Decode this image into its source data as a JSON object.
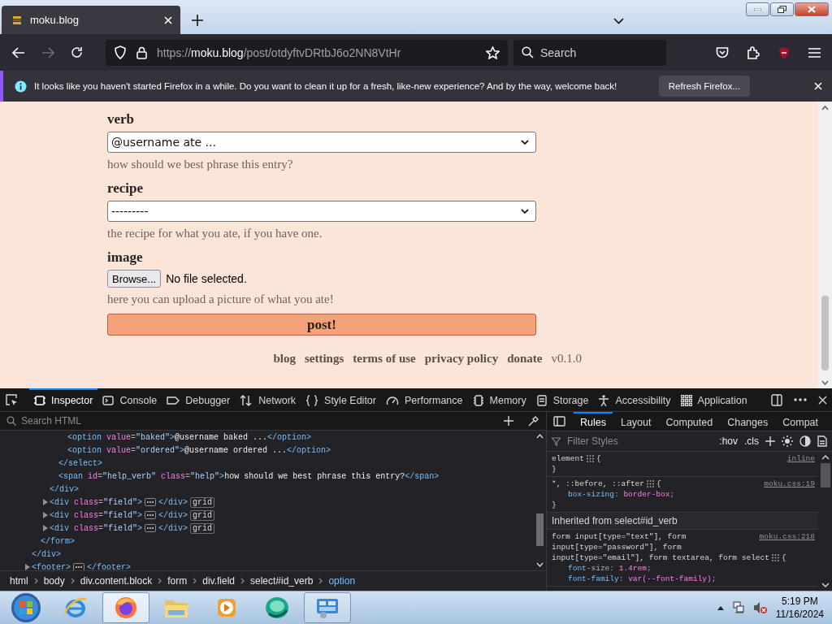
{
  "browser": {
    "tab": {
      "title": "moku.blog"
    },
    "url": {
      "scheme": "https://",
      "host": "moku.blog",
      "path": "/post/otdyftvDRtbJ6o2NN8VtHr"
    },
    "search": {
      "placeholder": "Search"
    }
  },
  "notification": {
    "message": "It looks like you haven't started Firefox in a while. Do you want to clean it up for a fresh, like-new experience? And by the way, welcome back!",
    "button": "Refresh Firefox..."
  },
  "form": {
    "fields": [
      {
        "kind": "select",
        "label": "verb",
        "value": "@username ate ...",
        "help": "how should we best phrase this entry?"
      },
      {
        "kind": "select",
        "label": "recipe",
        "value": "---------",
        "help": "the recipe for what you ate, if you have one."
      },
      {
        "kind": "file",
        "label": "image",
        "button": "Browse...",
        "value": "No file selected.",
        "help": "here you can upload a picture of what you ate!"
      }
    ],
    "submit": "post!"
  },
  "footer": {
    "links": [
      "blog",
      "settings",
      "terms of use",
      "privacy policy",
      "donate"
    ],
    "version": "v0.1.0"
  },
  "devtools": {
    "tools": [
      {
        "label": "Inspector",
        "selected": true
      },
      {
        "label": "Console",
        "selected": false
      },
      {
        "label": "Debugger",
        "selected": false
      },
      {
        "label": "Network",
        "selected": false
      },
      {
        "label": "Style Editor",
        "selected": false
      },
      {
        "label": "Performance",
        "selected": false
      },
      {
        "label": "Memory",
        "selected": false
      },
      {
        "label": "Storage",
        "selected": false
      },
      {
        "label": "Accessibility",
        "selected": false
      },
      {
        "label": "Application",
        "selected": false
      }
    ],
    "search": {
      "placeholder": "Search HTML"
    },
    "markup": [
      {
        "children": [
          {
            "children": [
              {
                "children": [
                  {
                    "children": [
                      {
                        "parts": [
                          {
                            "kind": "tag",
                            "text": "<option "
                          },
                          {
                            "kind": "attr",
                            "text": "value"
                          },
                          {
                            "kind": "punct",
                            "text": "="
                          },
                          {
                            "kind": "value",
                            "text": "\"baked\""
                          },
                          {
                            "kind": "tag",
                            "text": ">"
                          },
                          {
                            "kind": "content",
                            "text": "@username baked ..."
                          },
                          {
                            "kind": "tag",
                            "text": "</option>"
                          }
                        ]
                      },
                      {
                        "parts": [
                          {
                            "kind": "tag",
                            "text": "<option "
                          },
                          {
                            "kind": "attr",
                            "text": "value"
                          },
                          {
                            "kind": "punct",
                            "text": "="
                          },
                          {
                            "kind": "value",
                            "text": "\"ordered\""
                          },
                          {
                            "kind": "tag",
                            "text": ">"
                          },
                          {
                            "kind": "content",
                            "text": "@username ordered ..."
                          },
                          {
                            "kind": "tag",
                            "text": "</option>"
                          }
                        ]
                      }
                    ],
                    "close": [
                      {
                        "kind": "tag",
                        "text": "</select>"
                      }
                    ]
                  },
                  {
                    "parts": [
                      {
                        "kind": "tag",
                        "text": "<span "
                      },
                      {
                        "kind": "attr",
                        "text": "id"
                      },
                      {
                        "kind": "punct",
                        "text": "="
                      },
                      {
                        "kind": "value",
                        "text": "\"help_verb\" "
                      },
                      {
                        "kind": "attr",
                        "text": "class"
                      },
                      {
                        "kind": "punct",
                        "text": "="
                      },
                      {
                        "kind": "value",
                        "text": "\"help\""
                      },
                      {
                        "kind": "tag",
                        "text": ">"
                      },
                      {
                        "kind": "content",
                        "text": "how should we best phrase this entry?"
                      },
                      {
                        "kind": "tag",
                        "text": "</span>"
                      }
                    ]
                  }
                ],
                "close": [
                  {
                    "kind": "tag",
                    "text": "</div>"
                  }
                ]
              },
              {
                "expanded": false,
                "parts": [
                  {
                    "kind": "tag",
                    "text": "<div "
                  },
                  {
                    "kind": "attr",
                    "text": "class"
                  },
                  {
                    "kind": "punct",
                    "text": "="
                  },
                  {
                    "kind": "value",
                    "text": "\"field\""
                  },
                  {
                    "kind": "tag",
                    "text": ">"
                  }
                ],
                "close": [
                  {
                    "kind": "tag",
                    "text": "</div>"
                  }
                ],
                "badge": "grid"
              },
              {
                "expanded": false,
                "parts": [
                  {
                    "kind": "tag",
                    "text": "<div "
                  },
                  {
                    "kind": "attr",
                    "text": "class"
                  },
                  {
                    "kind": "punct",
                    "text": "="
                  },
                  {
                    "kind": "value",
                    "text": "\"field\""
                  },
                  {
                    "kind": "tag",
                    "text": ">"
                  }
                ],
                "close": [
                  {
                    "kind": "tag",
                    "text": "</div>"
                  }
                ],
                "badge": "grid"
              },
              {
                "expanded": false,
                "parts": [
                  {
                    "kind": "tag",
                    "text": "<div "
                  },
                  {
                    "kind": "attr",
                    "text": "class"
                  },
                  {
                    "kind": "punct",
                    "text": "="
                  },
                  {
                    "kind": "value",
                    "text": "\"field\""
                  },
                  {
                    "kind": "tag",
                    "text": ">"
                  }
                ],
                "close": [
                  {
                    "kind": "tag",
                    "text": "</div>"
                  }
                ],
                "badge": "grid"
              }
            ],
            "close": [
              {
                "kind": "tag",
                "text": "</form>"
              }
            ]
          }
        ],
        "close": [
          {
            "kind": "tag",
            "text": "</div>"
          }
        ]
      },
      {
        "expanded": false,
        "parts": [
          {
            "kind": "tag",
            "text": "<footer>"
          }
        ],
        "close": [
          {
            "kind": "tag",
            "text": "</footer>"
          }
        ]
      }
    ],
    "breadcrumbs": [
      {
        "label": "html",
        "selected": false
      },
      {
        "label": "body",
        "selected": false
      },
      {
        "label": "div.content.block",
        "selected": false
      },
      {
        "label": "form",
        "selected": false
      },
      {
        "label": "div.field",
        "selected": false
      },
      {
        "label": "select#id_verb",
        "selected": false
      },
      {
        "label": "option",
        "selected": true
      }
    ],
    "sidebar": {
      "tabs": [
        {
          "label": "Rules",
          "selected": true
        },
        {
          "label": "Layout",
          "selected": false
        },
        {
          "label": "Computed",
          "selected": false
        },
        {
          "label": "Changes",
          "selected": false
        },
        {
          "label": "Compat",
          "selected": false
        }
      ],
      "filter": {
        "placeholder": "Filter Styles"
      },
      "toggles": [
        ":hov",
        ".cls"
      ],
      "rules": [
        {
          "kind": "rule",
          "selector": [
            "element"
          ],
          "open": "{",
          "source": "inline",
          "close": "}"
        },
        {
          "kind": "rule",
          "selector": [
            "*, ::before, ::after"
          ],
          "open": "{",
          "source": "moku.css:19",
          "decls": [
            [
              {
                "kind": "prop",
                "text": "box-sizing"
              },
              {
                "kind": "punct",
                "text": ": "
              },
              {
                "kind": "val",
                "text": "border-box"
              },
              {
                "kind": "punct",
                "text": ";"
              }
            ]
          ],
          "close": "}"
        },
        {
          "kind": "inherited",
          "label": "Inherited from select#id_verb"
        },
        {
          "kind": "rule",
          "selector": [
            "form input[type=\"text\"], form",
            "input[type=\"password\"], form",
            "input[type=\"email\"], form textarea, form select"
          ],
          "open": "{",
          "source": "moku.css:218",
          "decls": [
            [
              {
                "kind": "prop",
                "text": "font-size"
              },
              {
                "kind": "punct",
                "text": ": "
              },
              {
                "kind": "val",
                "text": "1.4rem"
              },
              {
                "kind": "punct",
                "text": ";"
              }
            ],
            [
              {
                "kind": "prop",
                "text": "font-family"
              },
              {
                "kind": "punct",
                "text": ": "
              },
              {
                "kind": "val",
                "text": "var(--font-family)"
              },
              {
                "kind": "punct",
                "text": ";"
              }
            ]
          ]
        }
      ]
    }
  },
  "taskbar": {
    "apps": [
      {
        "open": false,
        "selected": false
      },
      {
        "open": true,
        "selected": true
      },
      {
        "open": false,
        "selected": false
      },
      {
        "open": false,
        "selected": false
      },
      {
        "open": false,
        "selected": false
      },
      {
        "open": true,
        "selected": false
      }
    ],
    "clock": {
      "time": "5:19 PM",
      "date": "11/16/2024"
    }
  }
}
